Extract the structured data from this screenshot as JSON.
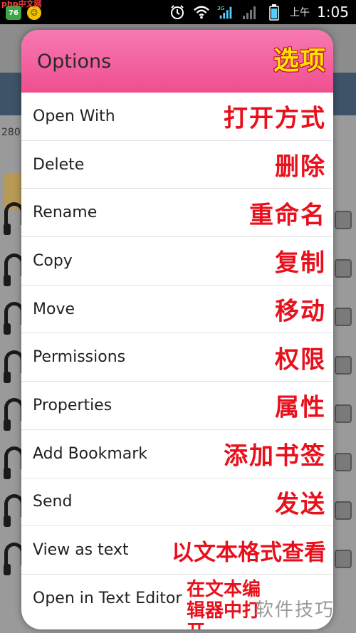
{
  "watermark_top": "php中文网",
  "status_bar": {
    "app_icons": [
      "green-app-icon",
      "yellow-app-icon"
    ],
    "icons": [
      "alarm-icon",
      "wifi-icon",
      "3g-signal-icon",
      "signal-icon",
      "battery-icon"
    ],
    "time_prefix": "上午",
    "time": "1:05"
  },
  "background": {
    "item_count": "280"
  },
  "dialog": {
    "title": "Options",
    "title_cn": "选项",
    "items": [
      {
        "label": "Open With",
        "cn": "打开方式"
      },
      {
        "label": "Delete",
        "cn": "删除"
      },
      {
        "label": "Rename",
        "cn": "重命名"
      },
      {
        "label": "Copy",
        "cn": "复制"
      },
      {
        "label": "Move",
        "cn": "移动"
      },
      {
        "label": "Permissions",
        "cn": "权限"
      },
      {
        "label": "Properties",
        "cn": "属性"
      },
      {
        "label": "Add Bookmark",
        "cn": "添加书签"
      },
      {
        "label": "Send",
        "cn": "发送"
      },
      {
        "label": "View as text",
        "cn": "以文本格式查看"
      },
      {
        "label": "Open in Text Editor",
        "cn": "在文本编辑器中打开"
      }
    ]
  },
  "watermark_bottom": "软件技巧",
  "colors": {
    "header_pink": "#ef4f8f",
    "title_cn_yellow": "#ffe600",
    "annotation_red": "#e8101c"
  }
}
